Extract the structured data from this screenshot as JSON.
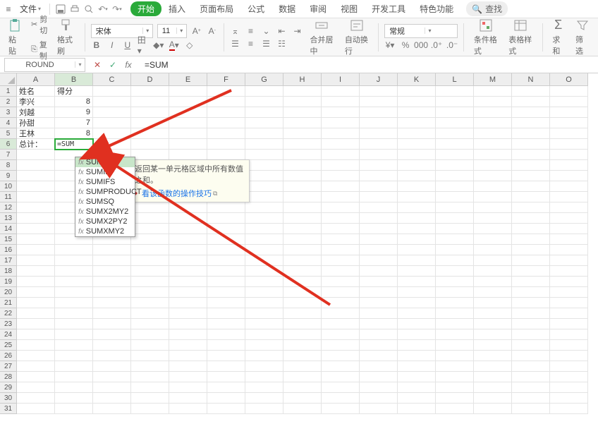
{
  "menubar": {
    "file": "文件",
    "tabs": [
      "开始",
      "插入",
      "页面布局",
      "公式",
      "数据",
      "审阅",
      "视图",
      "开发工具",
      "特色功能"
    ],
    "active_tab": 0,
    "search": "查找"
  },
  "ribbon": {
    "paste": "粘贴",
    "cut": "剪切",
    "copy": "复制",
    "format_painter": "格式刷",
    "font_name": "宋体",
    "font_size": "11",
    "merge_center": "合并居中",
    "wrap": "自动换行",
    "number_format": "常规",
    "cond_format": "条件格式",
    "table_style": "表格样式",
    "sum": "求和",
    "filter": "筛选"
  },
  "formula_bar": {
    "name_box": "ROUND",
    "formula": "=SUM"
  },
  "grid": {
    "columns": [
      "A",
      "B",
      "C",
      "D",
      "E",
      "F",
      "G",
      "H",
      "I",
      "J",
      "K",
      "L",
      "M",
      "N",
      "O"
    ],
    "rows": 31,
    "selected_col": 1,
    "selected_row": 5,
    "data": [
      [
        "姓名",
        "得分"
      ],
      [
        "李兴",
        "8"
      ],
      [
        "刘越",
        "9"
      ],
      [
        "孙甜",
        "7"
      ],
      [
        "王林",
        "8"
      ],
      [
        "总计：",
        "=SUM"
      ]
    ],
    "editing": {
      "row": 5,
      "col": 1
    }
  },
  "autocomplete": {
    "items": [
      "SUM",
      "SUMIF",
      "SUMIFS",
      "SUMPRODUCT",
      "SUMSQ",
      "SUMX2MY2",
      "SUMX2PY2",
      "SUMXMY2"
    ],
    "selected": 0
  },
  "tooltip": {
    "desc": "返回某一单元格区域中所有数值之和。",
    "link": "看该函数的操作技巧"
  }
}
